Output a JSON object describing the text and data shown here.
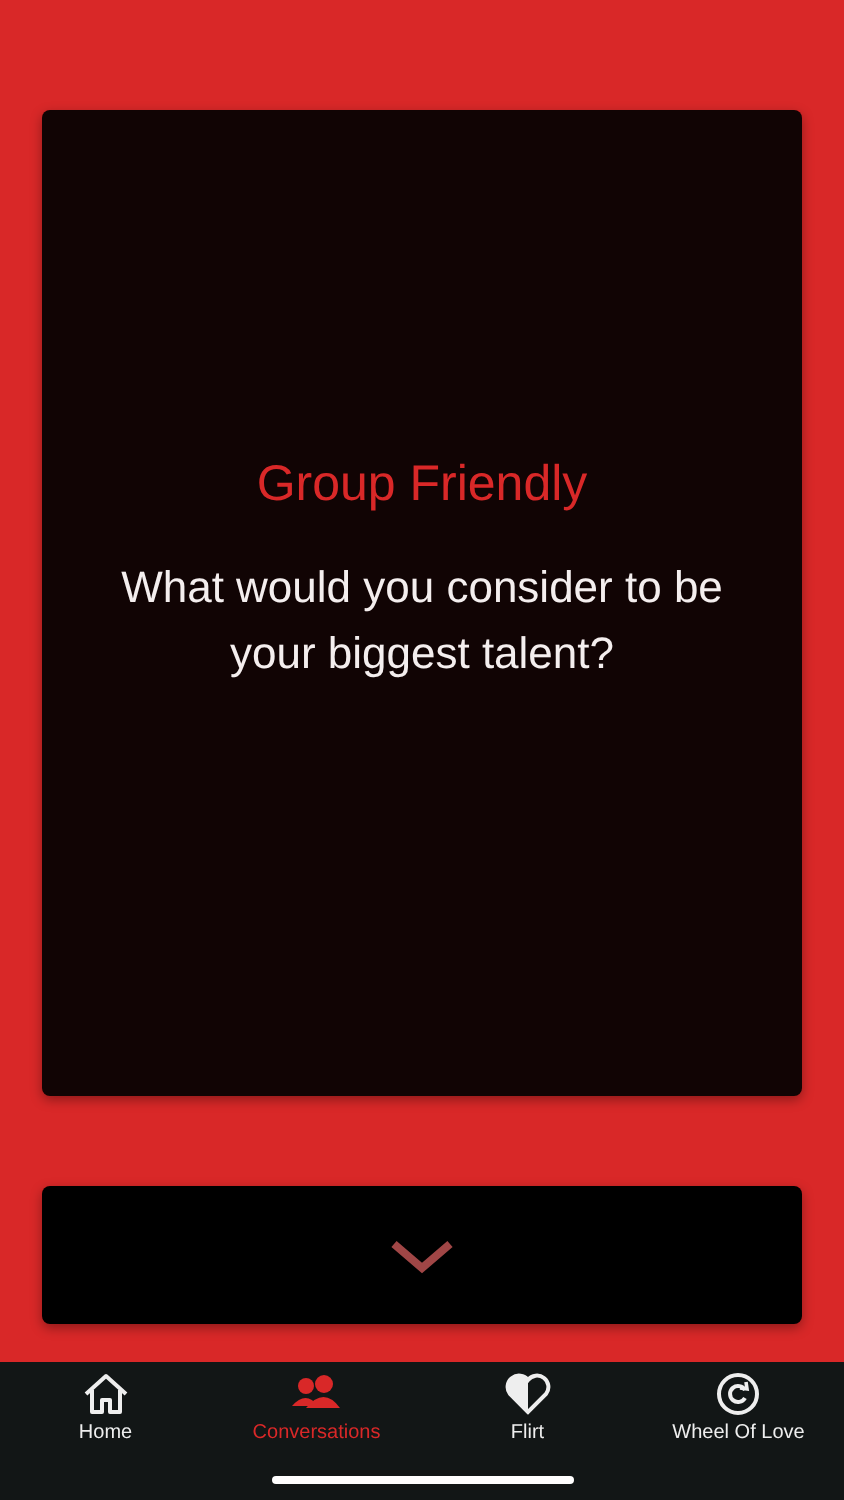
{
  "card": {
    "category": "Group Friendly",
    "question": "What would you consider to be your biggest talent?"
  },
  "next_button": {
    "kind": "chevron-down"
  },
  "tab_bar": {
    "tabs": [
      {
        "kind": "home",
        "label": "Home",
        "selected": false
      },
      {
        "kind": "people",
        "label": "Conversations",
        "selected": true
      },
      {
        "kind": "heart",
        "label": "Flirt",
        "selected": false
      },
      {
        "kind": "wheel",
        "label": "Wheel Of Love",
        "selected": false
      }
    ]
  }
}
